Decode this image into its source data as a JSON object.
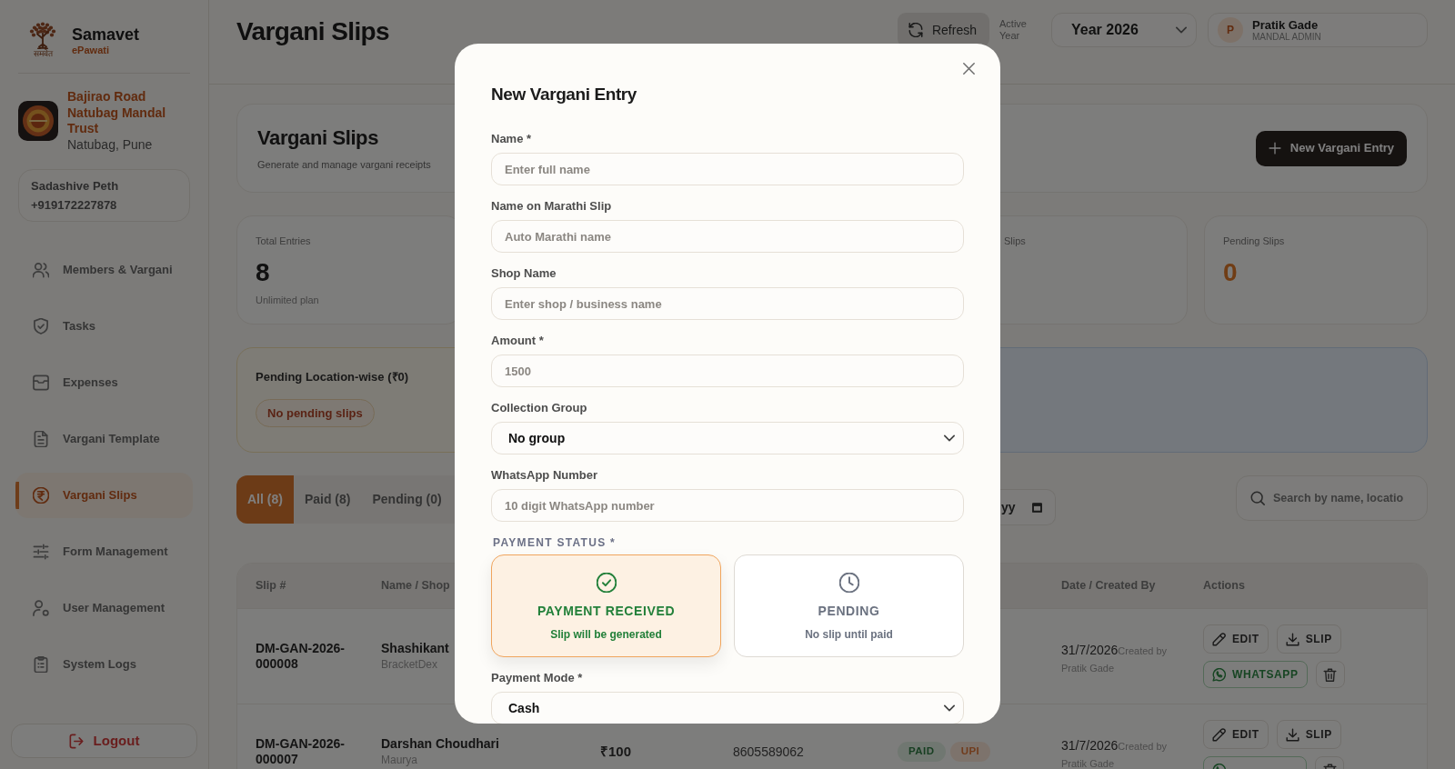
{
  "sidebar": {
    "brand": {
      "name": "Samavet",
      "tagline": "ePawati",
      "logo_caption": "समवेत"
    },
    "organization": {
      "name": "Bajirao Road Natubag Mandal Trust",
      "location": "Natubag, Pune"
    },
    "contact": {
      "area": "Sadashive Peth",
      "phone": "+919172227878"
    },
    "items": [
      {
        "label": "Members & Vargani",
        "selected": false
      },
      {
        "label": "Tasks",
        "selected": false
      },
      {
        "label": "Expenses",
        "selected": false
      },
      {
        "label": "Vargani Template",
        "selected": false
      },
      {
        "label": "Vargani Slips",
        "selected": true
      },
      {
        "label": "Form Management",
        "selected": false
      },
      {
        "label": "User Management",
        "selected": false
      },
      {
        "label": "System Logs",
        "selected": false
      }
    ],
    "logout": {
      "label": "Logout"
    }
  },
  "topbar": {
    "title": "Vargani Slips",
    "refresh": "Refresh",
    "active_year_label": "Active Year",
    "year": "Year 2026",
    "user": {
      "initial": "P",
      "name": "Pratik Gade",
      "role": "MANDAL ADMIN"
    }
  },
  "page_header": {
    "title": "Vargani Slips",
    "subtitle": "Generate and manage vargani receipts",
    "new_entry_button": "New Vargani Entry"
  },
  "stats": [
    {
      "label": "Total Entries",
      "value": "8",
      "note": "Unlimited plan",
      "kind": "count"
    },
    {
      "label": "Slips"
    },
    {
      "label": "Pending Slips",
      "value": "0",
      "kind": "pending"
    }
  ],
  "pending_summary": {
    "title": "Pending Location-wise (₹0)",
    "empty_label": "No pending slips"
  },
  "filters": {
    "tabs": [
      {
        "label": "All (8)",
        "selected": true
      },
      {
        "label": "Paid (8)",
        "selected": false
      },
      {
        "label": "Pending (0)",
        "selected": false
      }
    ],
    "date_filter": {
      "text": "yy"
    },
    "search": {
      "placeholder": "Search by name, locatio"
    }
  },
  "table": {
    "columns": {
      "slip": "Slip #",
      "name_shop": "Name / Shop",
      "date_created": "Date / Created By",
      "actions": "Actions"
    },
    "rows": [
      {
        "slip": "DM-GAN-2026-000008",
        "name": "Shashikant",
        "shop": "BracketDex",
        "date": "31/7/2026",
        "created_label": "Created by",
        "created_by": "Pratik Gade",
        "actions": [
          {
            "kind": "edit",
            "label": "EDIT"
          },
          {
            "kind": "slip",
            "label": "SLIP"
          },
          {
            "kind": "whatsapp",
            "label": "WHATSAPP"
          },
          {
            "kind": "delete"
          }
        ]
      },
      {
        "slip": "DM-GAN-2026-000007",
        "name": "Darshan Choudhari",
        "shop": "Maurya",
        "amount": "₹100",
        "phone": "8605589062",
        "badges": [
          {
            "kind": "status",
            "label": "PAID"
          },
          {
            "kind": "mode",
            "label": "UPI"
          }
        ],
        "date": "31/7/2026",
        "created_label": "Created by",
        "created_by": "Pratik Gade",
        "actions": [
          {
            "kind": "edit",
            "label": "EDIT"
          },
          {
            "kind": "slip",
            "label": "SLIP"
          },
          {
            "kind": "whatsapp"
          },
          {
            "kind": "delete"
          }
        ]
      }
    ]
  },
  "modal": {
    "title": "New Vargani Entry",
    "fields": [
      {
        "kind": "input",
        "label": "Name *",
        "placeholder": "Enter full name"
      },
      {
        "kind": "input",
        "label": "Name on Marathi Slip",
        "placeholder": "Auto Marathi name"
      },
      {
        "kind": "input",
        "label": "Shop Name",
        "placeholder": "Enter shop / business name"
      },
      {
        "kind": "input",
        "label": "Amount *",
        "placeholder": "1500"
      },
      {
        "kind": "select",
        "label": "Collection Group",
        "value": "No group"
      },
      {
        "kind": "input",
        "label": "WhatsApp Number",
        "placeholder": "10 digit WhatsApp number"
      }
    ],
    "payment_status": {
      "label": "PAYMENT STATUS *",
      "options": [
        {
          "kind": "received",
          "title": "PAYMENT RECEIVED",
          "note": "Slip will be generated",
          "selected": true
        },
        {
          "kind": "pending",
          "title": "PENDING",
          "note": "No slip until paid",
          "selected": false
        }
      ]
    },
    "payment_mode": {
      "label": "Payment Mode *",
      "value": "Cash"
    }
  }
}
